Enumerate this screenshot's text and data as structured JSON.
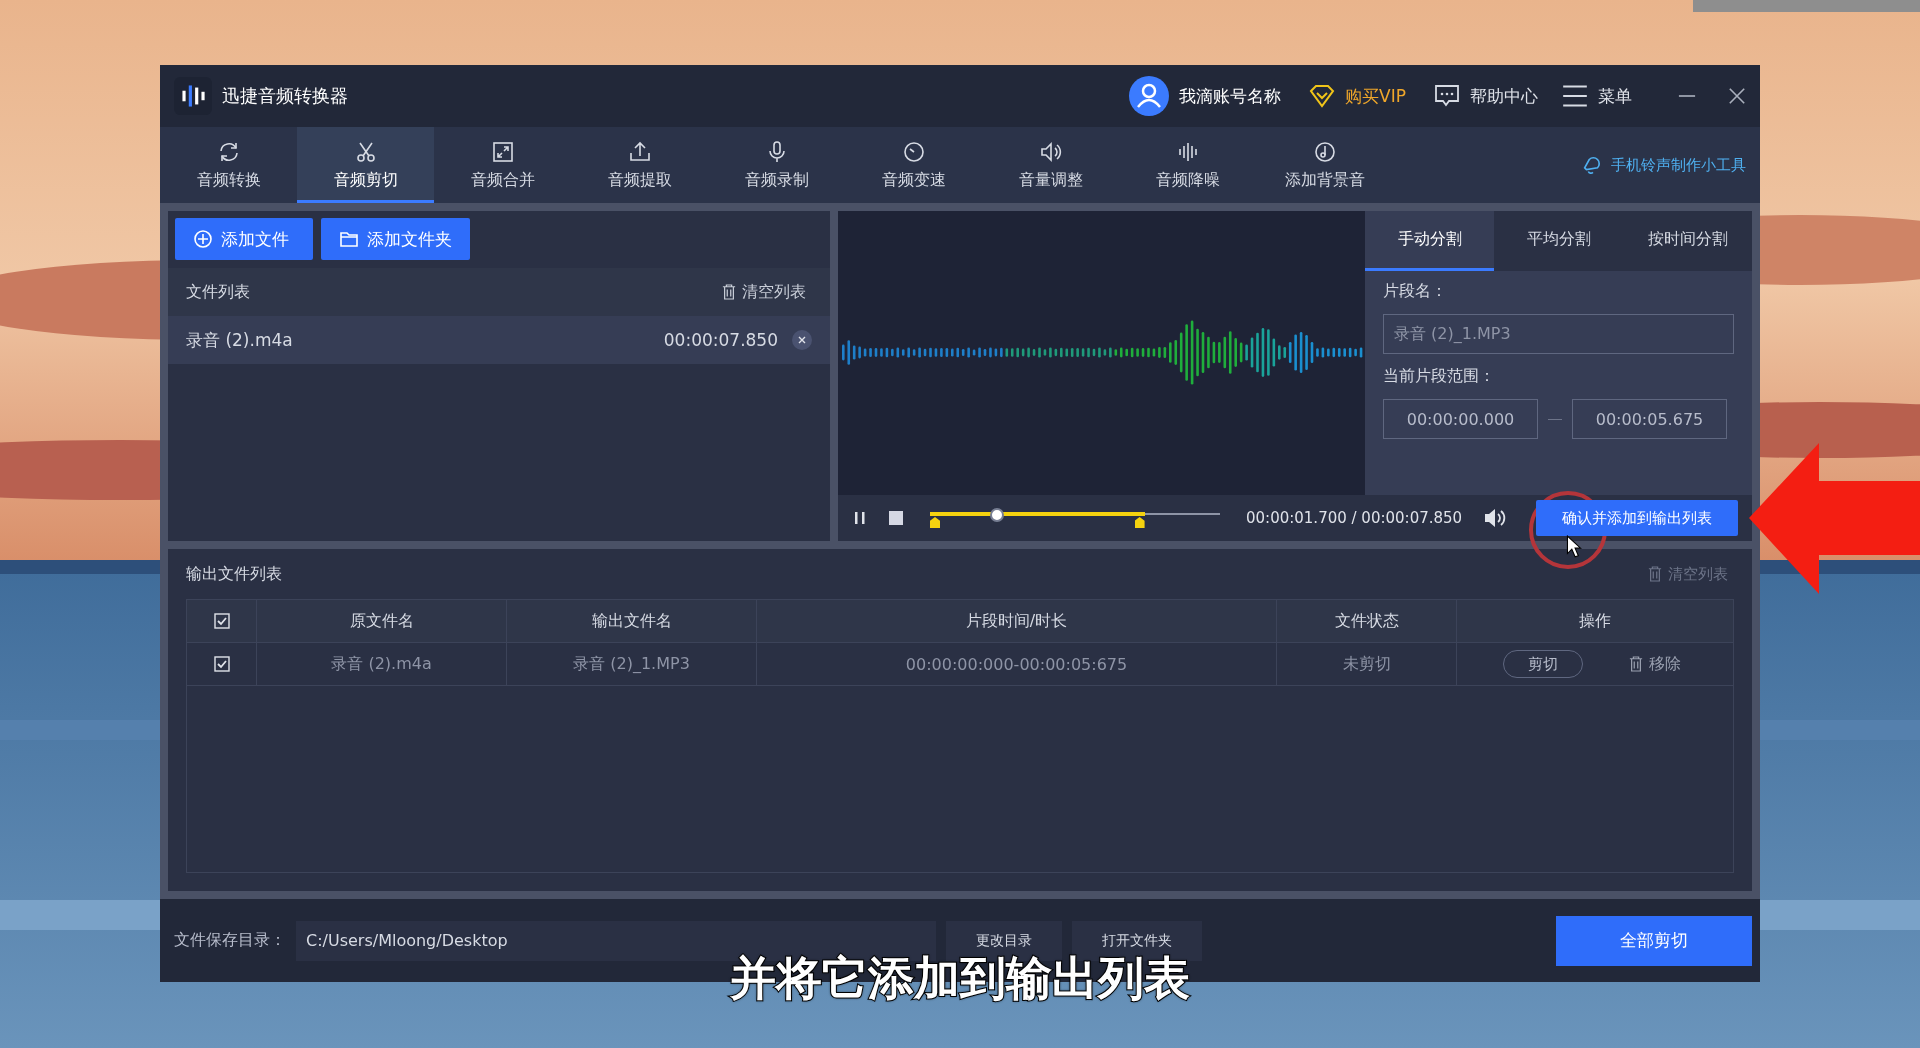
{
  "window": {
    "title": "迅捷音频转换器"
  },
  "header": {
    "account": "我滴账号名称",
    "vip": "购买VIP",
    "help": "帮助中心",
    "menu": "菜单"
  },
  "tools": [
    {
      "label": "音频转换",
      "kind": "convert",
      "selected": false
    },
    {
      "label": "音频剪切",
      "kind": "cut",
      "selected": true
    },
    {
      "label": "音频合并",
      "kind": "merge",
      "selected": false
    },
    {
      "label": "音频提取",
      "kind": "extract",
      "selected": false
    },
    {
      "label": "音频录制",
      "kind": "record",
      "selected": false
    },
    {
      "label": "音频变速",
      "kind": "speed",
      "selected": false
    },
    {
      "label": "音量调整",
      "kind": "volume",
      "selected": false
    },
    {
      "label": "音频降噪",
      "kind": "denoise",
      "selected": false
    },
    {
      "label": "添加背景音",
      "kind": "bgm",
      "selected": false
    }
  ],
  "ringtone_tool": "手机铃声制作小工具",
  "file_panel": {
    "add_file": "添加文件",
    "add_folder": "添加文件夹",
    "title": "文件列表",
    "clear": "清空列表",
    "files": [
      {
        "name": "录音 (2).m4a",
        "duration": "00:00:07.850"
      }
    ]
  },
  "player": {
    "time": "00:00:01.700 / 00:00:07.850",
    "playhead": {
      "level": 0.23
    }
  },
  "split_tabs": [
    {
      "label": "手动分割",
      "selected": true
    },
    {
      "label": "平均分割",
      "selected": false
    },
    {
      "label": "按时间分割",
      "selected": false
    }
  ],
  "segment": {
    "name_label": "片段名：",
    "name": "录音 (2)_1.MP3",
    "range_label": "当前片段范围：",
    "start": "00:00:00.000",
    "end": "00:00:05.675",
    "confirm": "确认并添加到输出列表"
  },
  "output": {
    "title": "输出文件列表",
    "clear": "清空列表",
    "all_checked": true,
    "columns": [
      "原文件名",
      "输出文件名",
      "片段时间/时长",
      "文件状态",
      "操作"
    ],
    "rows": [
      {
        "checked": true,
        "source": "录音 (2).m4a",
        "output": "录音 (2)_1.MP3",
        "range": "00:00:00:000-00:00:05:675",
        "status": "未剪切",
        "cut": "剪切",
        "remove": "移除"
      }
    ]
  },
  "footer": {
    "label": "文件保存目录：",
    "path": "C:/Users/Mloong/Desktop",
    "change": "更改目录",
    "open": "打开文件夹",
    "cut_all": "全部剪切"
  },
  "subtitle": "并将它添加到输出列表"
}
